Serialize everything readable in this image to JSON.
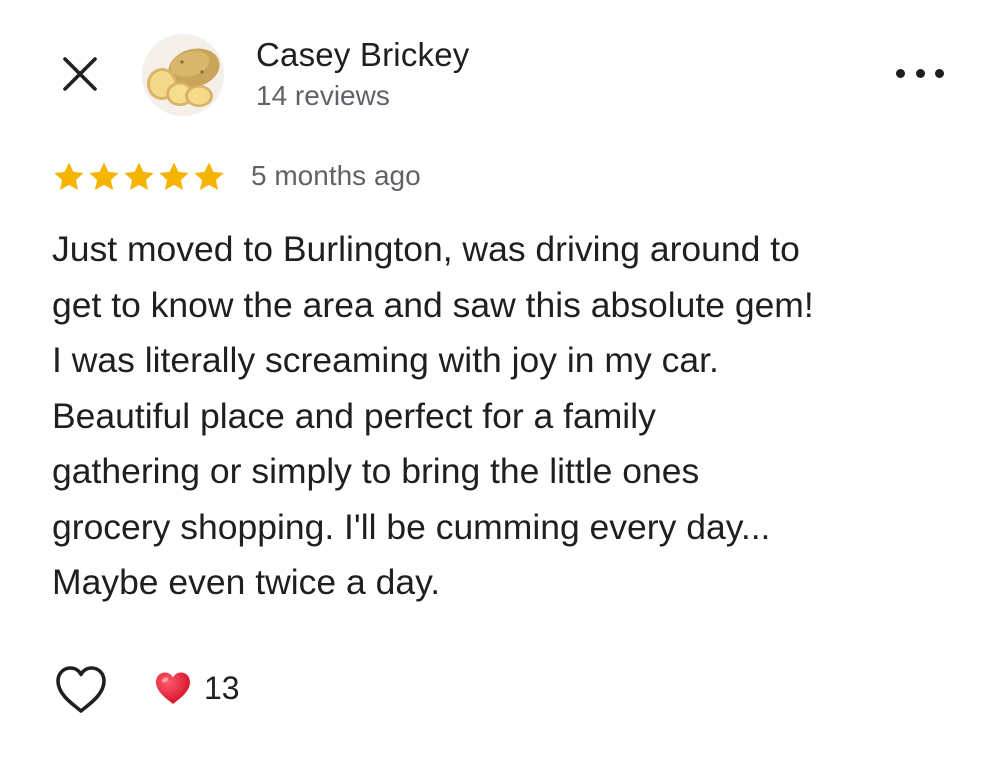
{
  "header": {
    "close_icon": "close-icon",
    "author": {
      "name": "Casey Brickey",
      "reviews": "14 reviews",
      "avatar_icon": "potato-avatar"
    },
    "more_icon": "more-horizontal-icon"
  },
  "rating": {
    "stars": 5,
    "max_stars": 5,
    "star_color": "#F4B400",
    "time_ago": "5 months ago"
  },
  "review": {
    "text": "Just moved to Burlington, was driving around to\nget to know the area and saw this absolute gem!\nI was literally screaming with joy in my car.\nBeautiful place and perfect for a family\ngathering or simply to bring the little ones\ngrocery shopping. I'll be cumming every day...\nMaybe even twice a day."
  },
  "footer": {
    "like_icon": "heart-outline-icon",
    "reaction_icon": "red-heart-icon",
    "reaction_color": "#E0243A",
    "reaction_count": "13"
  }
}
